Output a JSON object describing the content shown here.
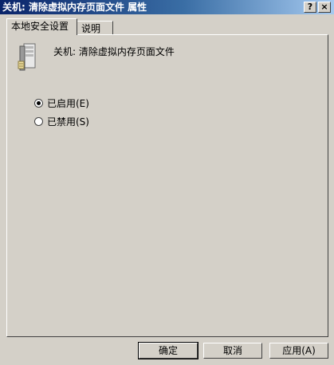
{
  "window": {
    "title": "关机: 清除虚拟内存页面文件 属性",
    "help_button": "?",
    "close_button": "×"
  },
  "tabs": [
    {
      "label": "本地安全设置",
      "active": true
    },
    {
      "label": "说明",
      "active": false
    }
  ],
  "policy": {
    "icon": "server-computer-icon",
    "name": "关机: 清除虚拟内存页面文件"
  },
  "options": {
    "enabled": {
      "label": "已启用(E)",
      "checked": true
    },
    "disabled": {
      "label": "已禁用(S)",
      "checked": false
    }
  },
  "buttons": {
    "ok": "确定",
    "cancel": "取消",
    "apply": "应用(A)"
  }
}
